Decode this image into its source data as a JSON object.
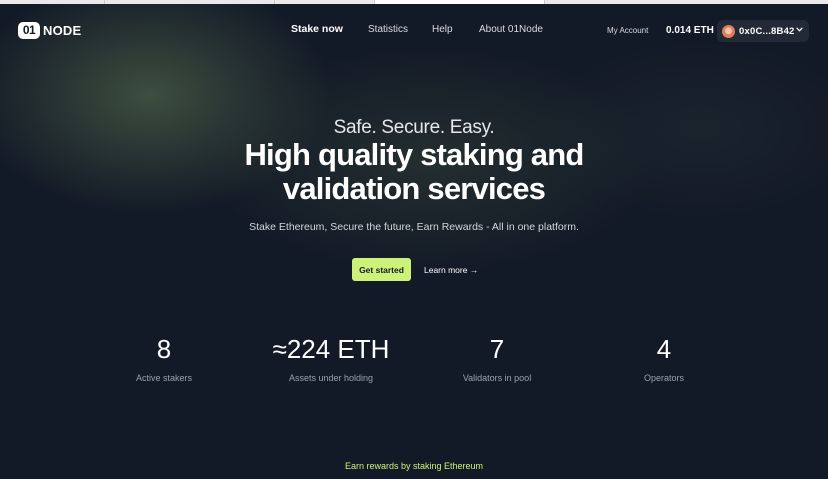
{
  "header": {
    "logo_mark": "01",
    "logo_text": "NODE",
    "nav": {
      "stake": "Stake now",
      "statistics": "Statistics",
      "help": "Help",
      "about": "About 01Node"
    },
    "my_account": "My Account",
    "balance": "0.014 ETH",
    "wallet_address": "0x0C...8B42"
  },
  "hero": {
    "tagline": "Safe. Secure. Easy.",
    "headline_line1": "High quality staking and",
    "headline_line2": "validation services",
    "subtext": "Stake Ethereum, Secure the future, Earn Rewards - All in one platform.",
    "cta": "Get started",
    "learn_more": "Learn more →"
  },
  "stats": [
    {
      "value": "8",
      "label": "Active stakers"
    },
    {
      "value": "≈224 ETH",
      "label": "Assets under holding"
    },
    {
      "value": "7",
      "label": "Validators in pool"
    },
    {
      "value": "4",
      "label": "Operators"
    }
  ],
  "footer": {
    "earn_heading": "Earn rewards by staking Ethereum"
  },
  "colors": {
    "background": "#131a27",
    "accent": "#cdf27a",
    "wallet_bg": "#232a37"
  },
  "icons": {
    "wallet_chevron": "chevron-down-icon",
    "wallet_avatar": "avatar"
  }
}
